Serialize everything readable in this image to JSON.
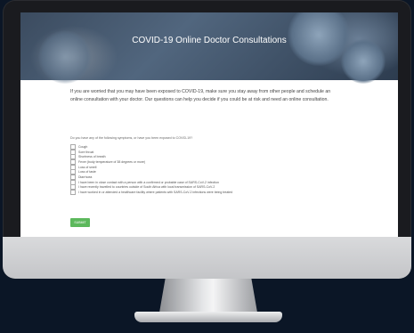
{
  "page": {
    "banner_title": "COVID-19 Online Doctor Consultations",
    "intro_text": "If you are worried that you may have been exposed to COVID-19, make sure you stay away from other people and schedule an online consultation with your doctor. Our questions can help you decide if you could be at risk and need an online consultation.",
    "question": "Do you have any of the following symptoms, or have you been exposed to COVID-19?",
    "symptoms": [
      "Cough",
      "Sore throat",
      "Shortness of breath",
      "Fever (body temperature of 38 degrees or more)",
      "Loss of smell",
      "Loss of taste",
      "Diarrhoea",
      "I have been in close contact with a person with a confirmed or probable case of SARS-CoV-2 infection",
      "I have recently travelled to countries outside of South Africa with local transmission of SARS-CoV-2",
      "I have worked in or attended a healthcare facility where patients with SARS-CoV-2 infections were being treated"
    ],
    "submit_label": "SUBMIT"
  },
  "colors": {
    "accent_green": "#5cb85c",
    "banner_blue": "#3b4b5f",
    "device_dark": "#1a1b1f",
    "background": "#0b1626"
  }
}
